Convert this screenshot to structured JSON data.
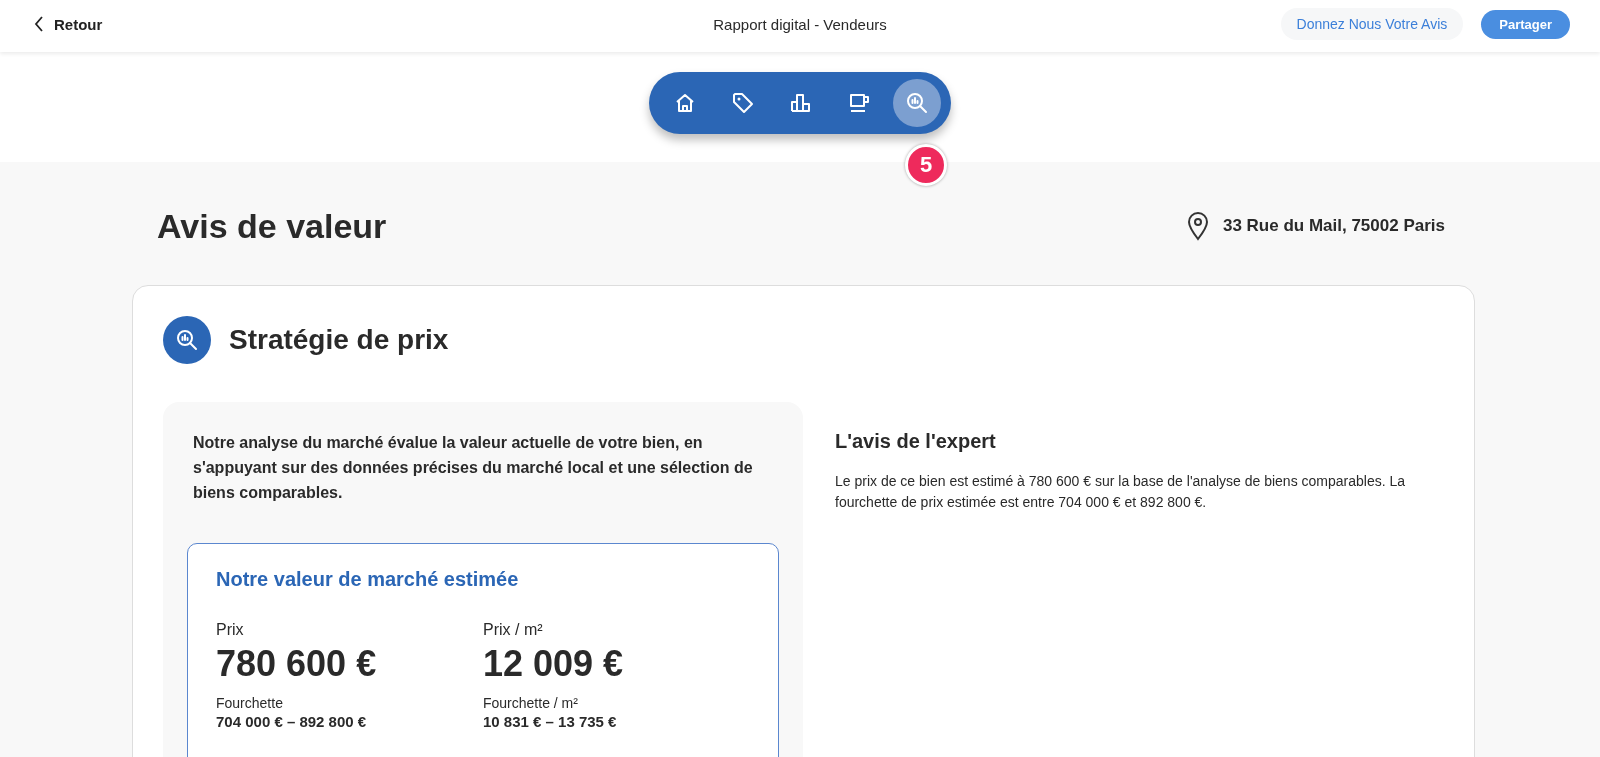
{
  "header": {
    "back_label": "Retour",
    "title": "Rapport digital - Vendeurs",
    "feedback_button": "Donnez Nous Votre Avis",
    "share_button": "Partager"
  },
  "nav": {
    "items": [
      {
        "kind": "home",
        "selected": false
      },
      {
        "kind": "tag",
        "selected": false
      },
      {
        "kind": "chart",
        "selected": false
      },
      {
        "kind": "cup",
        "selected": false
      },
      {
        "kind": "search",
        "selected": true
      }
    ],
    "badge": "5"
  },
  "page": {
    "title": "Avis de valeur",
    "address": "33 Rue du Mail, 75002 Paris"
  },
  "section": {
    "title": "Stratégie de prix",
    "intro": "Notre analyse du marché évalue la valeur actuelle de votre bien, en s'appuyant sur des données précises du marché local et une sélection de biens comparables.",
    "estimate": {
      "title": "Notre valeur de marché estimée",
      "metrics": [
        {
          "label": "Prix",
          "value": "780 600 €",
          "range_label": "Fourchette",
          "range": "704 000 € – 892 800 €"
        },
        {
          "label": "Prix / m²",
          "value": "12 009 €",
          "range_label": "Fourchette / m²",
          "range": "10 831 € – 13 735 €"
        }
      ]
    },
    "expert": {
      "title": "L'avis de l'expert",
      "text": "Le prix de ce bien est estimé à 780 600 € sur la base de l'analyse de biens comparables. La fourchette de prix estimée est entre 704 000 € et 892 800 €."
    }
  }
}
